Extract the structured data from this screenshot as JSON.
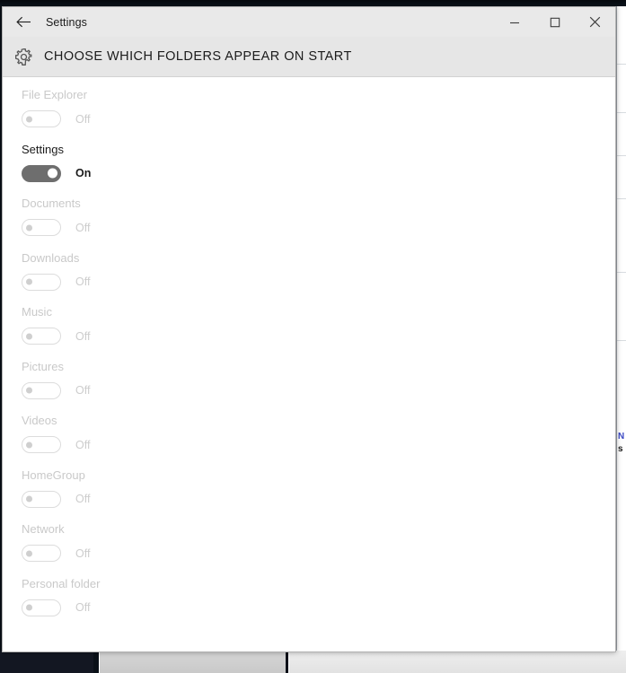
{
  "window": {
    "title": "Settings",
    "back_icon": "back-arrow-icon",
    "controls": {
      "minimize": "minimize-icon",
      "maximize": "maximize-icon",
      "close": "close-icon"
    }
  },
  "page": {
    "icon": "gear-icon",
    "title": "CHOOSE WHICH FOLDERS APPEAR ON START"
  },
  "folders": [
    {
      "label": "File Explorer",
      "state": "Off",
      "on": false
    },
    {
      "label": "Settings",
      "state": "On",
      "on": true
    },
    {
      "label": "Documents",
      "state": "Off",
      "on": false
    },
    {
      "label": "Downloads",
      "state": "Off",
      "on": false
    },
    {
      "label": "Music",
      "state": "Off",
      "on": false
    },
    {
      "label": "Pictures",
      "state": "Off",
      "on": false
    },
    {
      "label": "Videos",
      "state": "Off",
      "on": false
    },
    {
      "label": "HomeGroup",
      "state": "Off",
      "on": false
    },
    {
      "label": "Network",
      "state": "Off",
      "on": false
    },
    {
      "label": "Personal folder",
      "state": "Off",
      "on": false
    }
  ],
  "background": {
    "text_a": "N",
    "text_b": "s"
  },
  "colors": {
    "header_band": "#e6e6e6",
    "title_bar": "#e9e9e9",
    "toggle_on": "#6e6e6e",
    "toggle_off_border": "#dcdcdc",
    "disabled_text": "#c9c9c9",
    "enabled_text": "#1b1b1b",
    "desktop": "#0a1018"
  }
}
